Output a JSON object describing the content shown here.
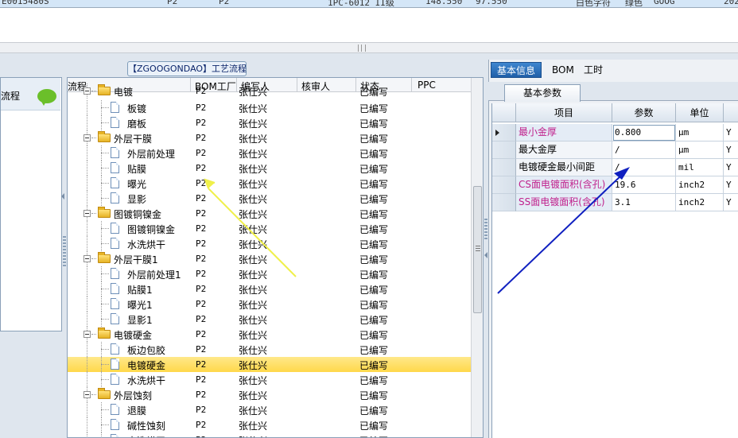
{
  "top_grid": {
    "cells": [
      "E0015480S",
      "P2",
      "P2",
      "1PC-6012 II级",
      "148.550",
      "97.550",
      "白色字符",
      "绿色",
      "GOOG",
      "202"
    ]
  },
  "flow_tab": {
    "label": "【ZGOOGONDAO】工艺流程"
  },
  "left_side": {
    "title": "流程"
  },
  "tree": {
    "headers": [
      "流程",
      "BOM工厂",
      "编写人",
      "核审人",
      "状态",
      "PPC"
    ],
    "rows": [
      {
        "label": "电镀",
        "level": 1,
        "bom": "P2",
        "writer": "张仕兴",
        "state": "已编写"
      },
      {
        "label": "板镀",
        "level": 2,
        "bom": "P2",
        "writer": "张仕兴",
        "state": "已编写"
      },
      {
        "label": "磨板",
        "level": 2,
        "bom": "P2",
        "writer": "张仕兴",
        "state": "已编写"
      },
      {
        "label": "外层干膜",
        "level": 1,
        "bom": "P2",
        "writer": "张仕兴",
        "state": "已编写"
      },
      {
        "label": "外层前处理",
        "level": 2,
        "bom": "P2",
        "writer": "张仕兴",
        "state": "已编写"
      },
      {
        "label": "贴膜",
        "level": 2,
        "bom": "P2",
        "writer": "张仕兴",
        "state": "已编写"
      },
      {
        "label": "曝光",
        "level": 2,
        "bom": "P2",
        "writer": "张仕兴",
        "state": "已编写"
      },
      {
        "label": "显影",
        "level": 2,
        "bom": "P2",
        "writer": "张仕兴",
        "state": "已编写"
      },
      {
        "label": "图镀铜镍金",
        "level": 1,
        "bom": "P2",
        "writer": "张仕兴",
        "state": "已编写"
      },
      {
        "label": "图镀铜镍金",
        "level": 2,
        "bom": "P2",
        "writer": "张仕兴",
        "state": "已编写"
      },
      {
        "label": "水洗烘干",
        "level": 2,
        "bom": "P2",
        "writer": "张仕兴",
        "state": "已编写"
      },
      {
        "label": "外层干膜1",
        "level": 1,
        "bom": "P2",
        "writer": "张仕兴",
        "state": "已编写"
      },
      {
        "label": "外层前处理1",
        "level": 2,
        "bom": "P2",
        "writer": "张仕兴",
        "state": "已编写"
      },
      {
        "label": "贴膜1",
        "level": 2,
        "bom": "P2",
        "writer": "张仕兴",
        "state": "已编写"
      },
      {
        "label": "曝光1",
        "level": 2,
        "bom": "P2",
        "writer": "张仕兴",
        "state": "已编写"
      },
      {
        "label": "显影1",
        "level": 2,
        "bom": "P2",
        "writer": "张仕兴",
        "state": "已编写"
      },
      {
        "label": "电镀硬金",
        "level": 1,
        "bom": "P2",
        "writer": "张仕兴",
        "state": "已编写"
      },
      {
        "label": "板边包胶",
        "level": 2,
        "bom": "P2",
        "writer": "张仕兴",
        "state": "已编写"
      },
      {
        "label": "电镀硬金",
        "level": 2,
        "bom": "P2",
        "writer": "张仕兴",
        "state": "已编写",
        "selected": true
      },
      {
        "label": "水洗烘干",
        "level": 2,
        "bom": "P2",
        "writer": "张仕兴",
        "state": "已编写"
      },
      {
        "label": "外层蚀刻",
        "level": 1,
        "bom": "P2",
        "writer": "张仕兴",
        "state": "已编写"
      },
      {
        "label": "退膜",
        "level": 2,
        "bom": "P2",
        "writer": "张仕兴",
        "state": "已编写"
      },
      {
        "label": "碱性蚀刻",
        "level": 2,
        "bom": "P2",
        "writer": "张仕兴",
        "state": "已编写"
      },
      {
        "label": "水洗烘干",
        "level": 2,
        "bom": "P2",
        "writer": "张仕兴",
        "state": "已编写"
      }
    ]
  },
  "right": {
    "tabs": [
      "基本信息",
      "BOM",
      "工时"
    ],
    "sub_tab": "基本参数",
    "grid_headers": [
      "项目",
      "参数",
      "单位",
      "Y"
    ],
    "grid_rows": [
      {
        "item": "最小金厚",
        "value": "0.800",
        "unit": "μm",
        "flag": "Y",
        "highlight": true,
        "current": true
      },
      {
        "item": "最大金厚",
        "value": "/",
        "unit": "μm",
        "flag": "Y",
        "highlight": false
      },
      {
        "item": "电镀硬金最小间距",
        "value": "/",
        "unit": "mil",
        "flag": "Y",
        "highlight": false
      },
      {
        "item": "CS面电镀面积(含孔)",
        "value": "19.6",
        "unit": "inch2",
        "flag": "Y",
        "highlight": true
      },
      {
        "item": "SS面电镀面积(含孔)",
        "value": "3.1",
        "unit": "inch2",
        "flag": "Y",
        "highlight": true
      }
    ]
  },
  "colors": {
    "highlight_text": "#c0208c",
    "selection": "#ffd84a",
    "yellow_arrow": "#f0f04a",
    "blue_arrow": "#1020c0"
  }
}
